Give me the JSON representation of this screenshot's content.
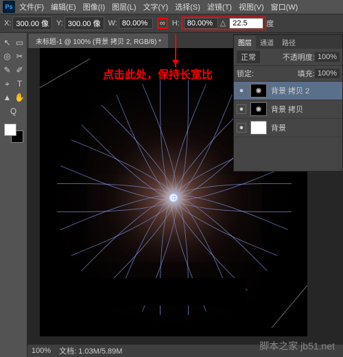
{
  "menu": {
    "items": [
      "文件(F)",
      "编辑(E)",
      "图像(I)",
      "图层(L)",
      "文字(Y)",
      "选择(S)",
      "滤镜(T)",
      "视图(V)",
      "窗口(W)"
    ]
  },
  "options": {
    "x_label": "X:",
    "x": "300.00 像",
    "y_label": "Y:",
    "y": "300.00 像",
    "w_label": "W:",
    "w": "80.00%",
    "link": "∞",
    "h_label": "H:",
    "h": "80.00%",
    "angle_icon": "△",
    "angle": "22.5",
    "angle_unit": "度"
  },
  "tab": {
    "title": "未标题-1 @ 100% (背景 拷贝 2, RGB/8) *"
  },
  "annotation": "点击此处，保持长宽比",
  "layers_panel": {
    "tabs": [
      "图层",
      "通道",
      "路径"
    ],
    "opacity_label": "不透明度:",
    "opacity": "100%",
    "lock_label": "锁定:",
    "fill_label": "填充:",
    "fill": "100%",
    "mode": "正常",
    "rows": [
      {
        "name": "背景 拷贝 2",
        "sel": true
      },
      {
        "name": "背景 拷贝",
        "sel": false
      },
      {
        "name": "背景",
        "sel": false
      }
    ]
  },
  "status": {
    "zoom": "100%",
    "doc": "文档: 1.03M/5.89M"
  },
  "watermark": "脚本之家 jb51.net",
  "tools": [
    "↖",
    "▭",
    "◎",
    "✂",
    "✎",
    "✐",
    "⌖",
    "T",
    "▲",
    "✋",
    "Q"
  ]
}
